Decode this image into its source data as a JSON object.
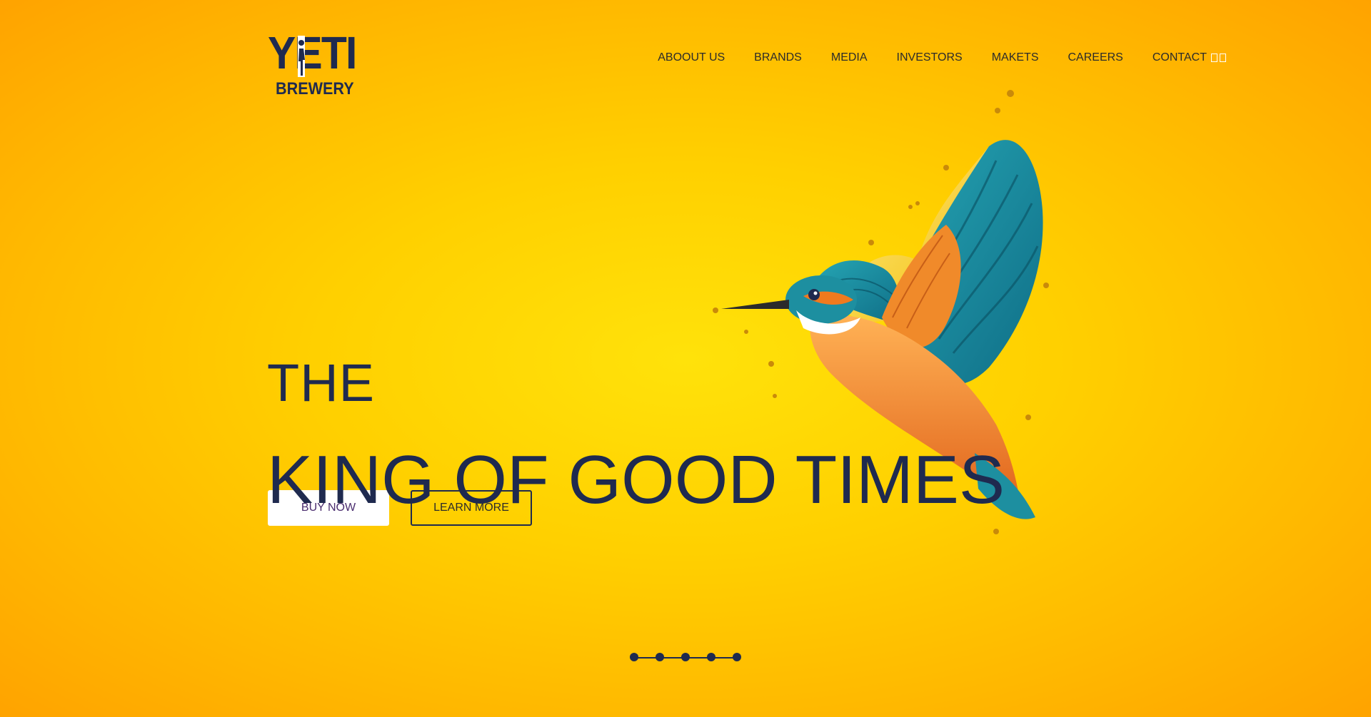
{
  "logo": {
    "top": "YETI",
    "bottom": "BREWERY"
  },
  "nav": {
    "items": [
      {
        "label": "ABOOUT US"
      },
      {
        "label": "BRANDS"
      },
      {
        "label": "MEDIA"
      },
      {
        "label": "INVESTORS"
      },
      {
        "label": "MAKETS"
      },
      {
        "label": "CAREERS"
      },
      {
        "label": "CONTACT"
      }
    ]
  },
  "hero": {
    "line1": "THE",
    "line2": "KING OF GOOD TIMES",
    "buy_label": "BUY NOW",
    "learn_label": "LEARN MORE"
  },
  "pager": {
    "count": 5,
    "active": 0
  },
  "colors": {
    "navy": "#1f2a4f",
    "accent_yellow": "#ffd000",
    "teal": "#1d8fa0",
    "orange": "#f07a1e"
  },
  "icons": {
    "hero_image": "kingfisher-bird-icon"
  }
}
